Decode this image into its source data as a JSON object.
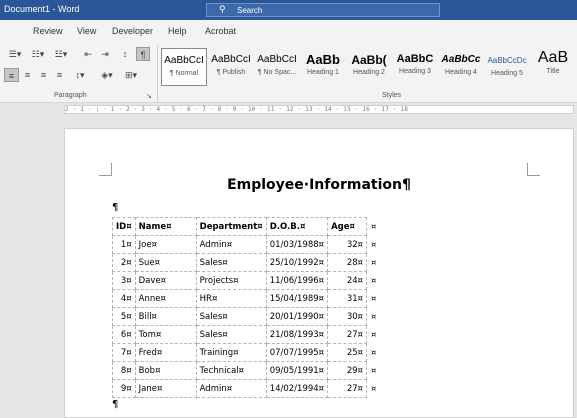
{
  "window": {
    "title": "Document1 - Word"
  },
  "search": {
    "label": "Search"
  },
  "tabs": [
    "Review",
    "View",
    "Developer",
    "Help",
    "Acrobat"
  ],
  "ribbon": {
    "paragraph_label": "Paragraph",
    "styles_label": "Styles",
    "styles": [
      {
        "sample": "AaBbCcI",
        "name": "¶ Normal"
      },
      {
        "sample": "AaBbCcI",
        "name": "¶ Publish"
      },
      {
        "sample": "AaBbCcI",
        "name": "¶ No Spac..."
      },
      {
        "sample": "AaBb",
        "name": "Heading 1"
      },
      {
        "sample": "AaBb(",
        "name": "Heading 2"
      },
      {
        "sample": "AaBbC",
        "name": "Heading 3"
      },
      {
        "sample": "AaBbCc",
        "name": "Heading 4"
      },
      {
        "sample": "AaBbCcDc",
        "name": "Heading 5"
      },
      {
        "sample": "AaB",
        "name": "Title"
      }
    ]
  },
  "ruler": {
    "text": "2 · 1 · ❘ · 1 · 2 · 3 · 4 · 5 · 6 · 7 · 8 · 9 · 10 · 11 · 12 · 13 · 14 · 15 · 16 · 17 · 18"
  },
  "document": {
    "title": "Employee·Information¶",
    "pilcrow": "¶",
    "table": {
      "headers": [
        "ID¤",
        "Name¤",
        "Department¤",
        "D.O.B.¤",
        "Age¤"
      ],
      "end_marker": "¤",
      "rows": [
        [
          "1¤",
          "Joe¤",
          "Admin¤",
          "01/03/1988¤",
          "32¤"
        ],
        [
          "2¤",
          "Sue¤",
          "Sales¤",
          "25/10/1992¤",
          "28¤"
        ],
        [
          "3¤",
          "Dave¤",
          "Projects¤",
          "11/06/1996¤",
          "24¤"
        ],
        [
          "4¤",
          "Anne¤",
          "HR¤",
          "15/04/1989¤",
          "31¤"
        ],
        [
          "5¤",
          "Bill¤",
          "Sales¤",
          "20/01/1990¤",
          "30¤"
        ],
        [
          "6¤",
          "Tom¤",
          "Sales¤",
          "21/08/1993¤",
          "27¤"
        ],
        [
          "7¤",
          "Fred¤",
          "Training¤",
          "07/07/1995¤",
          "25¤"
        ],
        [
          "8¤",
          "Bob¤",
          "Technical¤",
          "09/05/1991¤",
          "29¤"
        ],
        [
          "9¤",
          "Jane¤",
          "Admin¤",
          "14/02/1994¤",
          "27¤"
        ]
      ]
    }
  }
}
